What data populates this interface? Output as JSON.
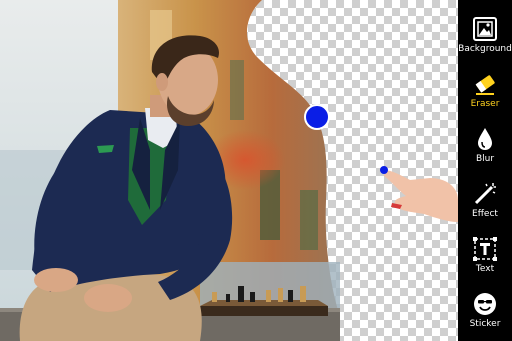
{
  "toolbar": {
    "items": [
      {
        "label": "Background",
        "icon": "background-image-icon",
        "active": false
      },
      {
        "label": "Eraser",
        "icon": "eraser-icon",
        "active": true
      },
      {
        "label": "Blur",
        "icon": "blur-drop-icon",
        "active": false
      },
      {
        "label": "Effect",
        "icon": "magic-wand-icon",
        "active": false
      },
      {
        "label": "Text",
        "icon": "text-frame-icon",
        "active": false
      },
      {
        "label": "Sticker",
        "icon": "sticker-smiley-icon",
        "active": false
      }
    ],
    "active_color": "#ffd21e",
    "text_color": "#ffffff"
  },
  "canvas": {
    "eraser_cursor_color": "#0a1ee6",
    "transparency_pattern": "checkerboard"
  }
}
